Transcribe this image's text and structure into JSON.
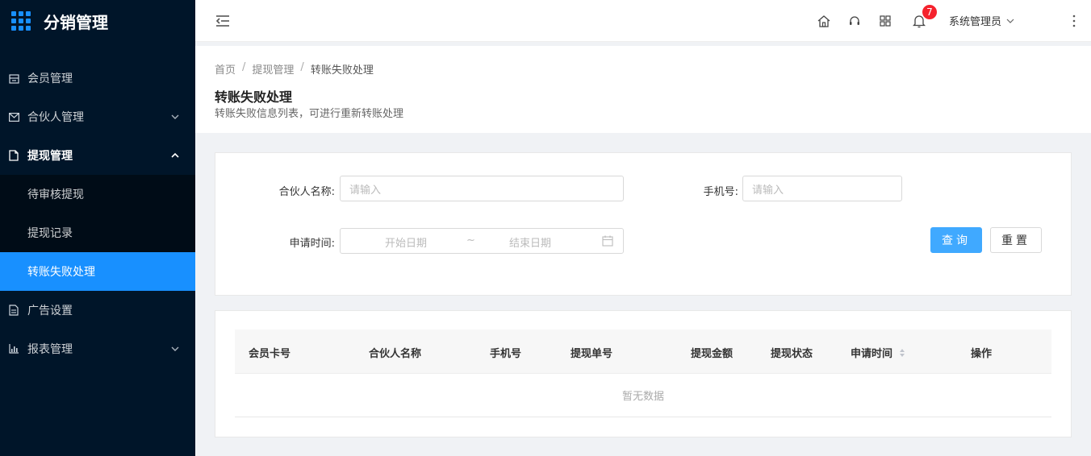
{
  "app": {
    "title": "分销管理"
  },
  "sidebar": {
    "items": [
      {
        "label": "会员管理",
        "icon": "member-icon"
      },
      {
        "label": "合伙人管理",
        "icon": "mail-icon"
      },
      {
        "label": "提现管理",
        "icon": "file-icon"
      },
      {
        "label": "广告设置",
        "icon": "document-icon"
      },
      {
        "label": "报表管理",
        "icon": "bar-chart-icon"
      }
    ],
    "withdraw_sub": [
      {
        "label": "待审核提现"
      },
      {
        "label": "提现记录"
      },
      {
        "label": "转账失败处理"
      }
    ]
  },
  "header": {
    "badge_count": "7",
    "user_name": "系统管理员"
  },
  "breadcrumb": {
    "home": "首页",
    "parent": "提现管理",
    "current": "转账失败处理",
    "separator": "/"
  },
  "page": {
    "title": "转账失败处理",
    "description": "转账失败信息列表，可进行重新转账处理"
  },
  "filter": {
    "partner_name_label": "合伙人名称:",
    "partner_name_placeholder": "请输入",
    "phone_label": "手机号:",
    "phone_placeholder": "请输入",
    "apply_time_label": "申请时间:",
    "start_date_placeholder": "开始日期",
    "range_separator": "~",
    "end_date_placeholder": "结束日期",
    "query_button": "查询",
    "reset_button": "重置"
  },
  "table": {
    "columns": [
      "会员卡号",
      "合伙人名称",
      "手机号",
      "提现单号",
      "提现金额",
      "提现状态",
      "申请时间",
      "操作"
    ],
    "empty_text": "暂无数据"
  },
  "colors": {
    "sidebar_bg": "#001529",
    "accent": "#1890ff",
    "badge": "#f5222d"
  }
}
